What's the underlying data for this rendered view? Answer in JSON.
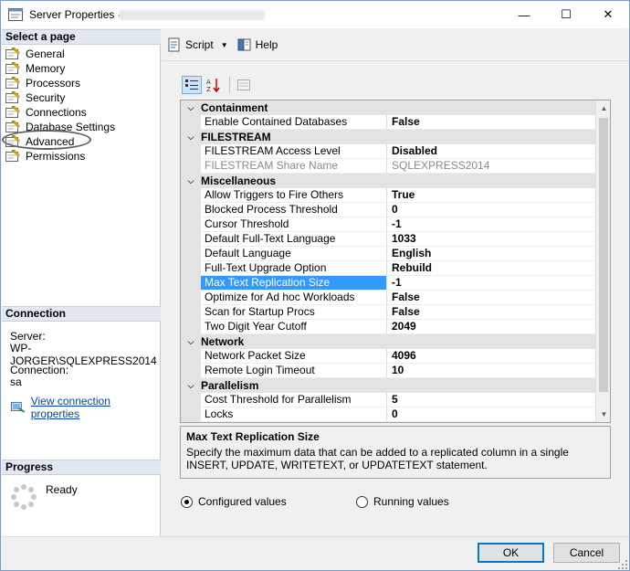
{
  "window": {
    "title": "Server Properties - ",
    "title_suffix_blurred": true,
    "controls": {
      "minimize": "—",
      "maximize": "☐",
      "close": "✕"
    }
  },
  "left": {
    "select_page_header": "Select a page",
    "pages": [
      {
        "label": "General",
        "icon": "wrench-icon"
      },
      {
        "label": "Memory",
        "icon": "wrench-icon"
      },
      {
        "label": "Processors",
        "icon": "wrench-icon"
      },
      {
        "label": "Security",
        "icon": "wrench-icon"
      },
      {
        "label": "Connections",
        "icon": "wrench-icon",
        "highlighted": true
      },
      {
        "label": "Database Settings",
        "icon": "wrench-icon"
      },
      {
        "label": "Advanced",
        "icon": "wrench-icon",
        "selected": true
      },
      {
        "label": "Permissions",
        "icon": "wrench-icon"
      }
    ],
    "connection_header": "Connection",
    "server_label": "Server:",
    "server_value": "WP-JORGER\\SQLEXPRESS2014",
    "connection_label": "Connection:",
    "connection_value": "sa",
    "view_link": "View connection properties",
    "progress_header": "Progress",
    "progress_status": "Ready"
  },
  "toolbar": {
    "script_label": "Script",
    "help_label": "Help"
  },
  "grid": {
    "categories": [
      {
        "name": "Containment",
        "rows": [
          {
            "name": "Enable Contained Databases",
            "value": "False"
          }
        ]
      },
      {
        "name": "FILESTREAM",
        "rows": [
          {
            "name": "FILESTREAM Access Level",
            "value": "Disabled"
          },
          {
            "name": "FILESTREAM Share Name",
            "value": "SQLEXPRESS2014",
            "disabled": true
          }
        ]
      },
      {
        "name": "Miscellaneous",
        "rows": [
          {
            "name": "Allow Triggers to Fire Others",
            "value": "True"
          },
          {
            "name": "Blocked Process Threshold",
            "value": "0"
          },
          {
            "name": "Cursor Threshold",
            "value": "-1"
          },
          {
            "name": "Default Full-Text Language",
            "value": "1033"
          },
          {
            "name": "Default Language",
            "value": "English"
          },
          {
            "name": "Full-Text Upgrade Option",
            "value": "Rebuild"
          },
          {
            "name": "Max Text Replication Size",
            "value": "-1",
            "selected": true
          },
          {
            "name": "Optimize for Ad hoc Workloads",
            "value": "False"
          },
          {
            "name": "Scan for Startup Procs",
            "value": "False"
          },
          {
            "name": "Two Digit Year Cutoff",
            "value": "2049"
          }
        ]
      },
      {
        "name": "Network",
        "rows": [
          {
            "name": "Network Packet Size",
            "value": "4096"
          },
          {
            "name": "Remote Login Timeout",
            "value": "10"
          }
        ]
      },
      {
        "name": "Parallelism",
        "rows": [
          {
            "name": "Cost Threshold for Parallelism",
            "value": "5"
          },
          {
            "name": "Locks",
            "value": "0"
          }
        ]
      }
    ]
  },
  "description": {
    "title": "Max Text Replication Size",
    "text": "Specify the maximum data that can be added to a replicated column in a single INSERT, UPDATE, WRITETEXT, or UPDATETEXT statement."
  },
  "view_mode": {
    "configured_label": "Configured values",
    "running_label": "Running values",
    "selected": "configured"
  },
  "buttons": {
    "ok": "OK",
    "cancel": "Cancel"
  }
}
